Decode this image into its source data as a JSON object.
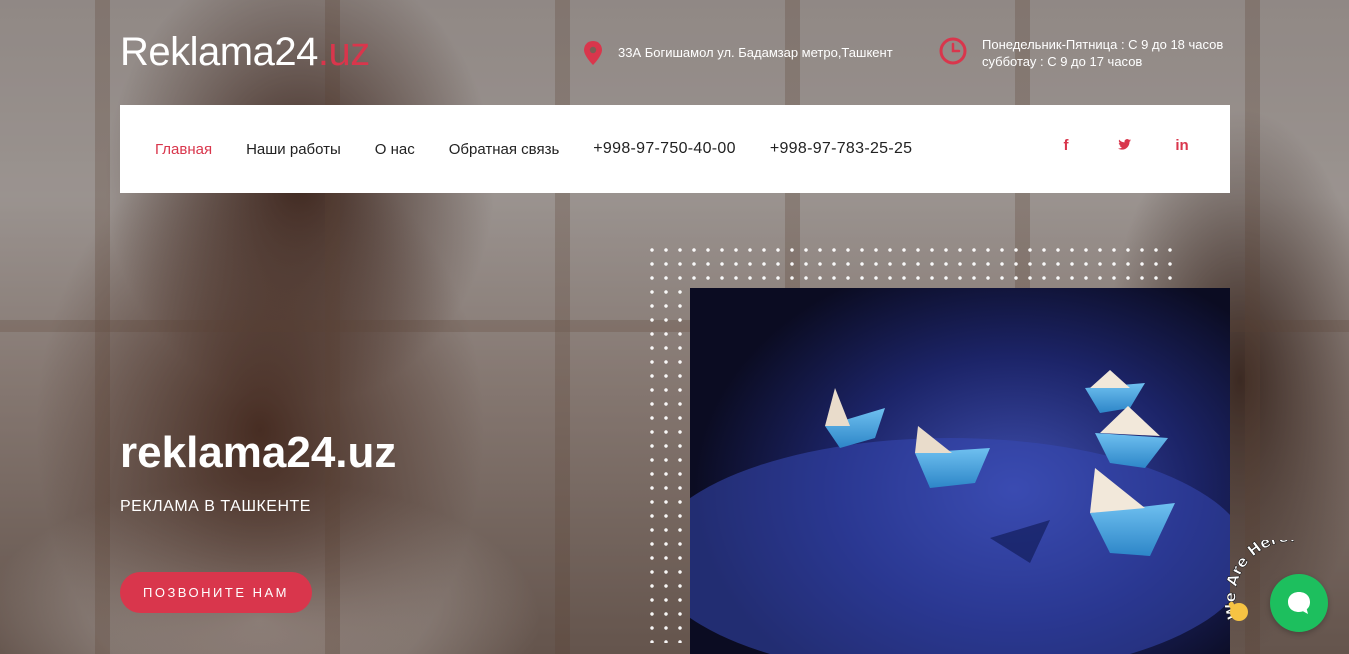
{
  "logo": {
    "name": "Reklama24",
    "tld": ".uz"
  },
  "header": {
    "address": "33А Богишамол ул. Бадамзар метро,Ташкент",
    "hours_line1": "Понедельник-Пятница : С 9 до 18 часов",
    "hours_line2": "субботау : С 9 до 17 часов"
  },
  "nav": {
    "items": [
      {
        "label": "Главная",
        "active": true
      },
      {
        "label": "Наши работы"
      },
      {
        "label": "О нас"
      },
      {
        "label": "Обратная связь"
      }
    ],
    "phones": [
      "+998-97-750-40-00",
      "+998-97-783-25-25"
    ],
    "social": [
      "facebook-icon",
      "twitter-icon",
      "linkedin-icon"
    ]
  },
  "hero": {
    "title": "reklama24.uz",
    "subtitle": "РЕКЛАМА В ТАШКЕНТЕ",
    "cta_label": "ПОЗВОНИТЕ НАМ"
  },
  "chat": {
    "badge_text": "We Are Here!"
  },
  "colors": {
    "accent": "#d9364c",
    "chat": "#1dbf5e",
    "white": "#ffffff"
  }
}
